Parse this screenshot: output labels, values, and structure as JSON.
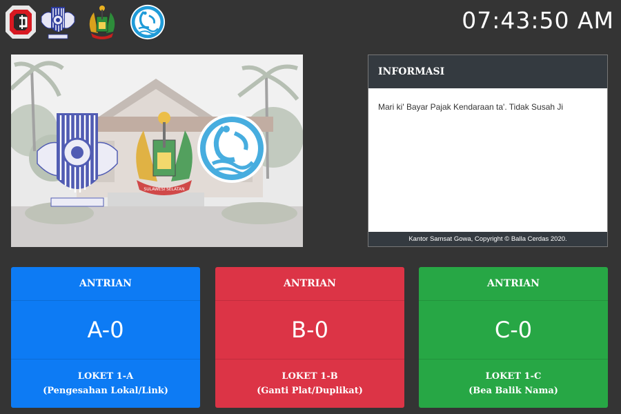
{
  "header": {
    "clock": "07:43:50 AM",
    "logos": [
      "balla-cerdas-logo-icon",
      "polri-logo-icon",
      "sulsel-emblem-icon",
      "jasa-raharja-logo-icon"
    ]
  },
  "info": {
    "title": "INFORMASI",
    "message": "Mari ki' Bayar Pajak Kendaraan ta'. Tidak Susah Ji",
    "footer": "Kantor Samsat Gowa, Copyright © Balla Cerdas 2020."
  },
  "queues": [
    {
      "header": "ANTRIAN",
      "number": "A-0",
      "counter": "LOKET 1-A",
      "service": "(Pengesahan Lokal/Link)",
      "color": "#0d7bf4"
    },
    {
      "header": "ANTRIAN",
      "number": "B-0",
      "counter": "LOKET 1-B",
      "service": "(Ganti Plat/Duplikat)",
      "color": "#dc3446"
    },
    {
      "header": "ANTRIAN",
      "number": "C-0",
      "counter": "LOKET 1-C",
      "service": "(Bea Balik Nama)",
      "color": "#27a745"
    }
  ],
  "photo": {
    "emblem_text": "SULAWESI SELATAN"
  }
}
